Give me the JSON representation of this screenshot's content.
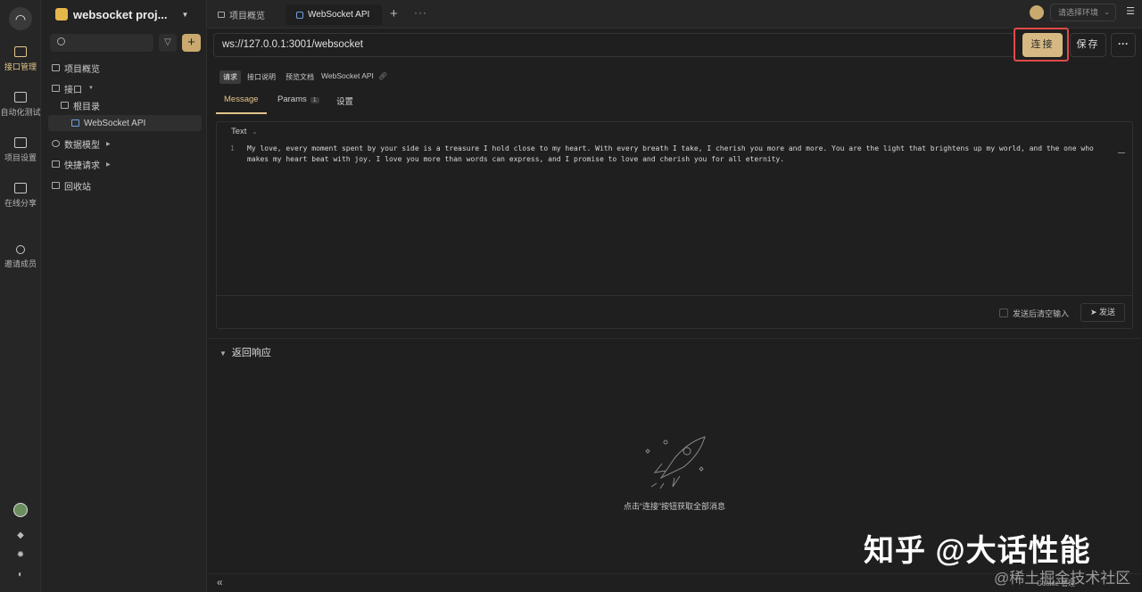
{
  "rail": {
    "items": [
      {
        "label": "接口管理",
        "icon": "api-manage-icon",
        "active": true
      },
      {
        "label": "自动化测试",
        "icon": "automation-icon",
        "active": false
      },
      {
        "label": "项目设置",
        "icon": "project-settings-icon",
        "active": false
      },
      {
        "label": "在线分享",
        "icon": "share-icon",
        "active": false
      },
      {
        "label": "邀请成员",
        "icon": "invite-icon",
        "active": false
      }
    ]
  },
  "sidebar": {
    "project_name": "websocket proj...",
    "tree": [
      {
        "label": "项目概览"
      },
      {
        "label": "接口"
      },
      {
        "label": "根目录"
      },
      {
        "label": "WebSocket API"
      },
      {
        "label": "数据模型"
      },
      {
        "label": "快捷请求"
      },
      {
        "label": "回收站"
      }
    ]
  },
  "tabs": [
    {
      "label": "项目概览"
    },
    {
      "label": "WebSocket API"
    }
  ],
  "env": {
    "placeholder": "请选择环境"
  },
  "request": {
    "url": "ws://127.0.0.1:3001/websocket",
    "connect_label": "连接",
    "save_label": "保存",
    "more_label": "···"
  },
  "subtabs": [
    {
      "label": "请求"
    },
    {
      "label": "接口说明"
    },
    {
      "label": "预览文档"
    }
  ],
  "api_name": "WebSocket API",
  "panel_tabs": [
    {
      "label": "Message"
    },
    {
      "label": "Params",
      "badge": "1"
    },
    {
      "label": "设置"
    }
  ],
  "editor": {
    "format": "Text",
    "line_number": "1",
    "content": "My love, every moment spent by your side is a treasure I hold close to my heart. With every breath I take, I cherish you more and more. You are the light that brightens up my world, and the one who makes my heart beat with joy. I love you more than words can express, and I promise to love and cherish you for all eternity.",
    "clear_after_send": "发送后清空输入",
    "send_label": "发送"
  },
  "response": {
    "title": "返回响应",
    "empty_hint": "点击“连接”按钮获取全部消息"
  },
  "bottom": {
    "cookie": "Cookie 管理"
  },
  "watermark": {
    "main": "知乎 @大话性能",
    "sub": "@稀土掘金技术社区"
  },
  "colors": {
    "accent": "#d6b982",
    "highlight_border": "#e04a4a",
    "background": "#1f1f1f"
  }
}
